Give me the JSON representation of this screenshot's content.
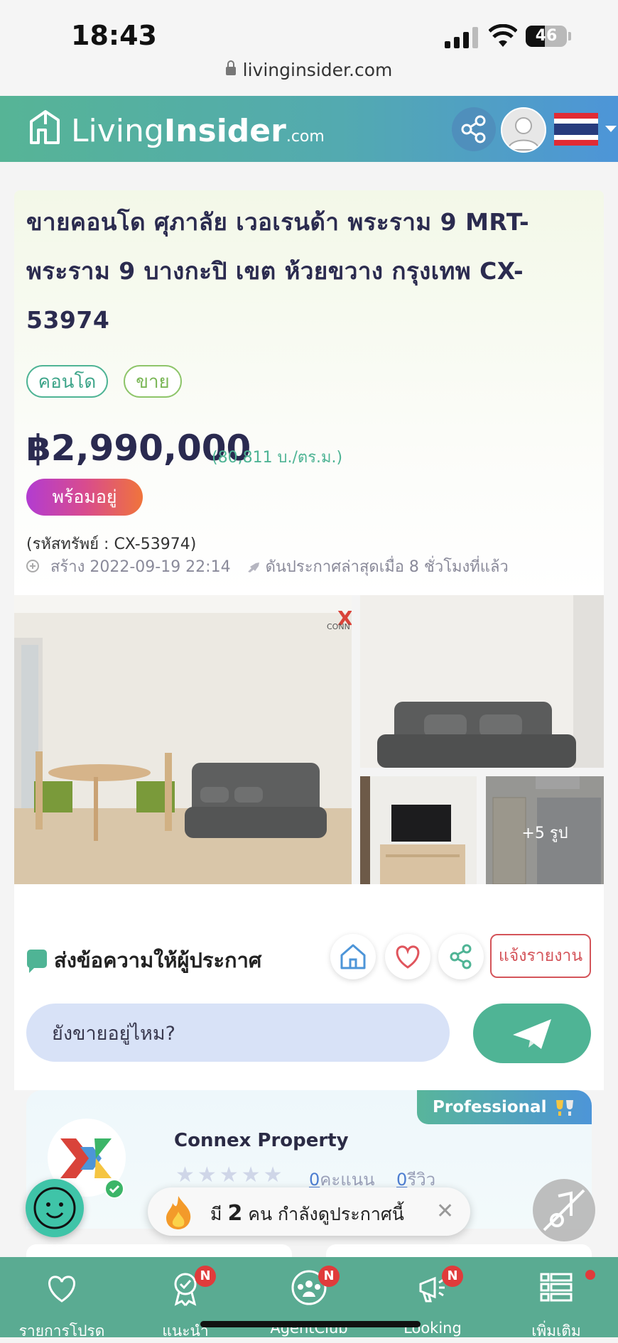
{
  "status_bar": {
    "time": "18:43",
    "battery": "46",
    "url": "livinginsider.com"
  },
  "header": {
    "logo_living": "Living",
    "logo_insider": "Insider",
    "logo_com": ".com",
    "share_icon": "share-icon",
    "avatar_icon": "user-avatar-icon",
    "flag": "thai-flag-icon"
  },
  "listing": {
    "title": "ขายคอนโด ศุภาลัย เวอเรนด้า พระราม 9 MRT-พระราม 9 บางกะปิ เขต ห้วยขวาง กรุงเทพ CX-53974",
    "tags": [
      "คอนโด",
      "ขาย"
    ],
    "price": "฿2,990,000",
    "price_per_sqm": "(80,811 บ./ตร.ม.)",
    "ready_badge": "พร้อมอยู่",
    "asset_code": "(รหัสทรัพย์ : CX-53974)",
    "created": "สร้าง 2022-09-19 22:14",
    "boosted": "ดันประกาศล่าสุดเมื่อ 8 ชั่วโมงที่แล้ว"
  },
  "photos": {
    "more_label": "+5 รูป",
    "watermark": "CONN"
  },
  "message": {
    "title": "ส่งข้อความให้ผู้ประกาศ",
    "report_label": "แจ้งรายงาน",
    "input_value": "ยังขายอยู่ไหม?",
    "icons": [
      "home-icon",
      "heart-icon",
      "share-icon",
      "send-icon"
    ]
  },
  "agent": {
    "badge": "Professional",
    "name": "Connex Property",
    "score_count": "0",
    "score_label": "คะแนน",
    "review_count": "0",
    "review_label": "รีวิว",
    "stars": 0
  },
  "viewers": {
    "prefix": "มี",
    "count": "2",
    "suffix": "คน กำลังดูประกาศนี้",
    "close": "✕"
  },
  "bottom_nav": [
    {
      "label": "รายการโปรด",
      "icon": "heart-icon",
      "badge": ""
    },
    {
      "label": "แนะนำ",
      "icon": "recommend-icon",
      "badge": "N"
    },
    {
      "label": "AgentClub",
      "icon": "agent-club-icon",
      "badge": "N"
    },
    {
      "label": "Looking",
      "icon": "megaphone-icon",
      "badge": "N"
    },
    {
      "label": "เพิ่มเติม",
      "icon": "menu-list-icon",
      "badge": ""
    }
  ],
  "colors": {
    "brand_green": "#4fb495",
    "brand_blue": "#4d95d8",
    "report_red": "#d4545a",
    "price_navy": "#2a2a50"
  }
}
